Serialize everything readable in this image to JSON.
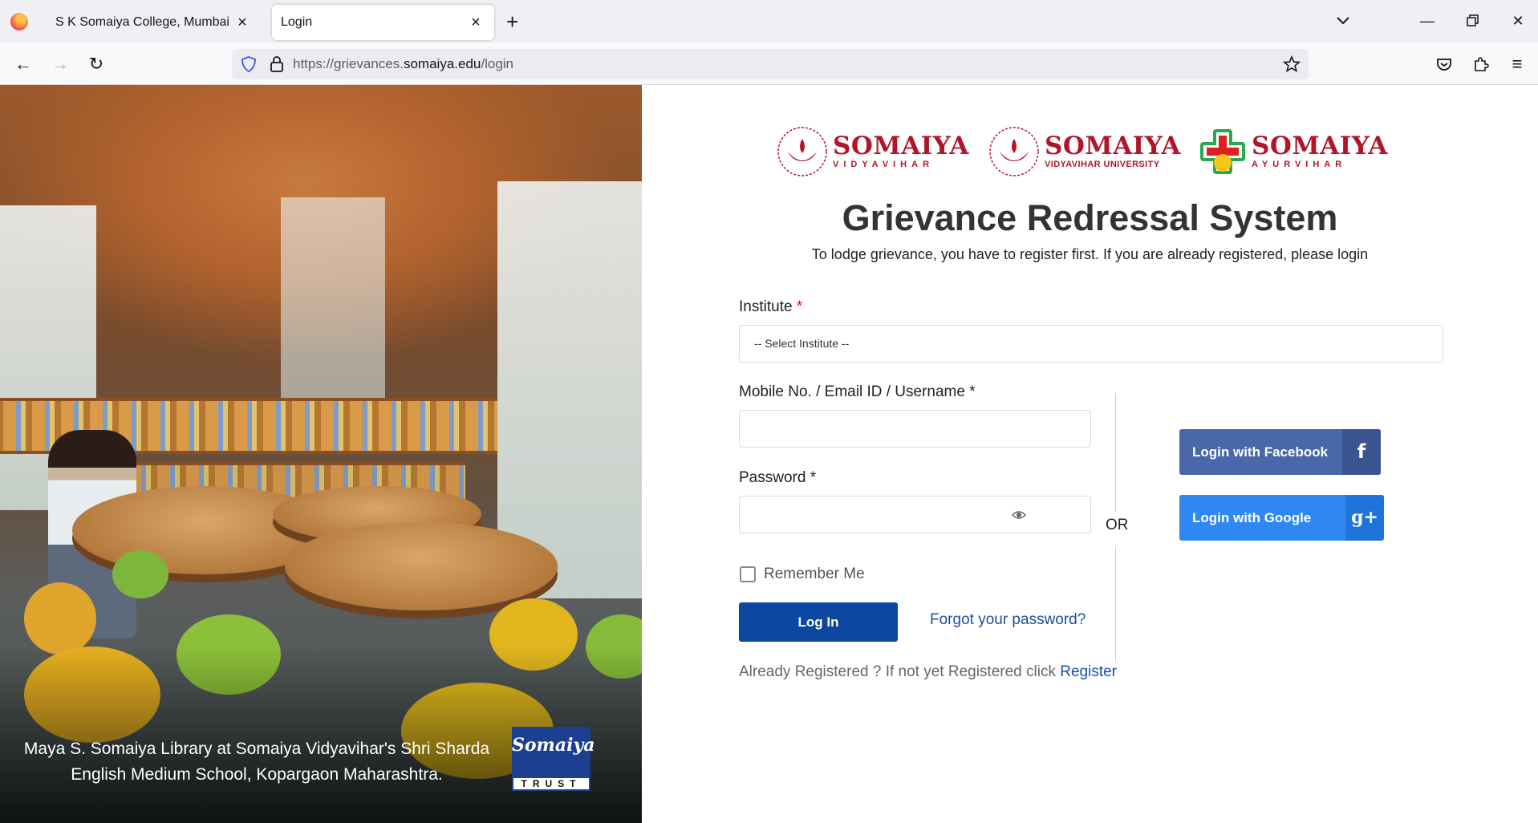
{
  "browser": {
    "tabs": [
      {
        "title": "S K Somaiya College, Mumbai",
        "active": false
      },
      {
        "title": "Login",
        "active": true
      }
    ],
    "url_prefix": "https://grievances.",
    "url_domain": "somaiya.edu",
    "url_suffix": "/login",
    "icons": [
      "firefox-icon",
      "close-icon",
      "new-tab-icon",
      "tab-list-icon",
      "minimize-icon",
      "restore-icon",
      "close-window-icon",
      "back-icon",
      "forward-icon",
      "reload-icon",
      "shield-icon",
      "lock-icon",
      "bookmark-star-icon",
      "pocket-icon",
      "extensions-icon",
      "menu-icon"
    ]
  },
  "hero": {
    "caption_line1": "Maya S. Somaiya Library at Somaiya Vidyavihar's Shri Sharda",
    "caption_line2": "English Medium School, Kopargaon Maharashtra.",
    "trust_logo_script": "Somaiya",
    "trust_logo_word": "TRUST"
  },
  "brands": [
    {
      "name": "SOMAIYA",
      "sub": "VIDYAVIHAR"
    },
    {
      "name": "SOMAIYA",
      "sub": "VIDYAVIHAR UNIVERSITY"
    },
    {
      "name": "SOMAIYA",
      "sub": "AYURVIHAR"
    }
  ],
  "form": {
    "title": "Grievance Redressal System",
    "subtitle": "To lodge grievance, you have to register first. If you are already registered, please login",
    "institute_label": "Institute",
    "required_mark": "*",
    "institute_selected": "-- Select Institute --",
    "username_label": "Mobile No. / Email ID / Username *",
    "username_value": "",
    "password_label": "Password *",
    "password_value": "",
    "remember_label": "Remember Me",
    "login_button": "Log In",
    "forgot_link": "Forgot your password?",
    "already_text": "Already Registered ? If not yet Registered click ",
    "register_link": "Register",
    "or_text": "OR",
    "facebook_button": "Login with Facebook",
    "google_button": "Login with Google",
    "facebook_glyph": "f",
    "google_glyph": "g+"
  },
  "colors": {
    "primary_button": "#0c47a1",
    "link": "#1a4fa0",
    "brand_red": "#b2152a",
    "facebook": "#4a68a9",
    "google": "#2f88f1"
  }
}
